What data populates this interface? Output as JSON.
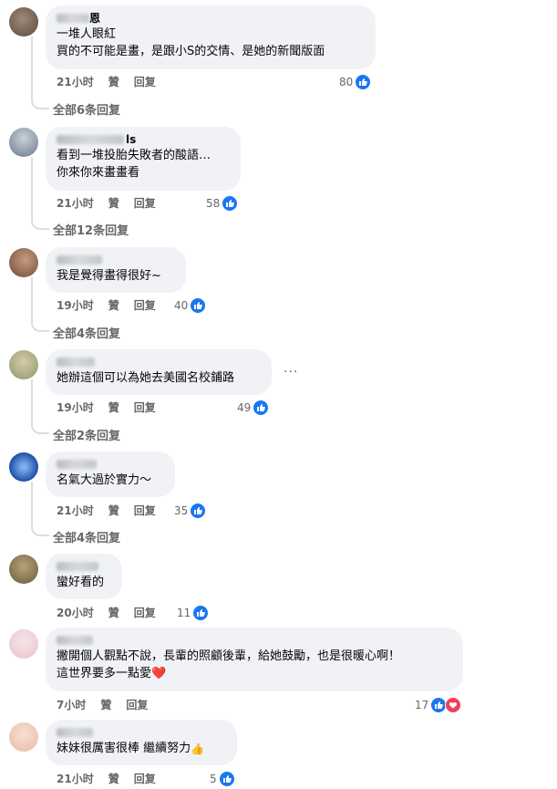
{
  "comments": [
    {
      "name_tail": "恩",
      "lines": [
        "一堆人眼紅",
        "買的不可能是畫，是跟小S的交情、是她的新聞版面"
      ],
      "time": "21小时",
      "like": "贊",
      "reply": "回复",
      "count": "80",
      "more": "全部6条回复",
      "avatar_colors": [
        "#5a4a3e",
        "#a08a78"
      ]
    },
    {
      "name_tail": "ls",
      "lines": [
        "看到一堆投胎失敗者的酸語…",
        "你來你來畫畫看"
      ],
      "time": "21小时",
      "like": "贊",
      "reply": "回复",
      "count": "58",
      "more": "全部12条回复",
      "avatar_colors": [
        "#6c7a8a",
        "#c9d1da"
      ]
    },
    {
      "name_tail": "",
      "lines": [
        "我是覺得畫得很好~"
      ],
      "time": "19小时",
      "like": "贊",
      "reply": "回复",
      "count": "40",
      "more": "全部4条回复",
      "avatar_colors": [
        "#6b4a3a",
        "#c89a80"
      ]
    },
    {
      "name_tail": "",
      "lines": [
        "她辦這個可以為她去美國名校鋪路"
      ],
      "time": "19小时",
      "like": "贊",
      "reply": "回复",
      "count": "49",
      "more": "全部2条回复",
      "avatar_colors": [
        "#8a9a6a",
        "#d8c9a8"
      ]
    },
    {
      "name_tail": "",
      "lines": [
        "名氣大過於實力～"
      ],
      "time": "21小时",
      "like": "贊",
      "reply": "回复",
      "count": "35",
      "more": "全部4条回复",
      "avatar_colors": [
        "#1e4fa8",
        "#7fb0f0"
      ]
    },
    {
      "name_tail": "",
      "lines": [
        "蠻好看的"
      ],
      "time": "20小时",
      "like": "贊",
      "reply": "回复",
      "count": "11",
      "more": "",
      "avatar_colors": [
        "#6a5a3a",
        "#b9a27a"
      ]
    },
    {
      "name_tail": "",
      "lines": [
        "撇開個人觀點不說，長輩的照顧後輩，給她鼓勵，也是很暖心啊！",
        "這世界要多一點愛"
      ],
      "time": "7小时",
      "like": "贊",
      "reply": "回复",
      "count": "17",
      "more": "",
      "avatar_colors": [
        "#e8c4cc",
        "#f6e4e8"
      ]
    },
    {
      "name_tail": "",
      "lines": [
        "妹妹很厲害很棒 繼續努力"
      ],
      "time": "21小时",
      "like": "贊",
      "reply": "回复",
      "count": "5",
      "more": "",
      "avatar_colors": [
        "#e8b9a8",
        "#f8e0d0"
      ]
    }
  ],
  "ellipsis": "···",
  "icons": {
    "like": "like-icon",
    "love": "love-icon",
    "more": "more-options-icon",
    "heart": "heart-emoji",
    "thumb": "thumbs-up-emoji"
  },
  "colors": {
    "like_blue": "#1877f2",
    "love_red": "#f33e58",
    "bubble_bg": "#f0f2f5",
    "meta_gray": "#65676b"
  }
}
